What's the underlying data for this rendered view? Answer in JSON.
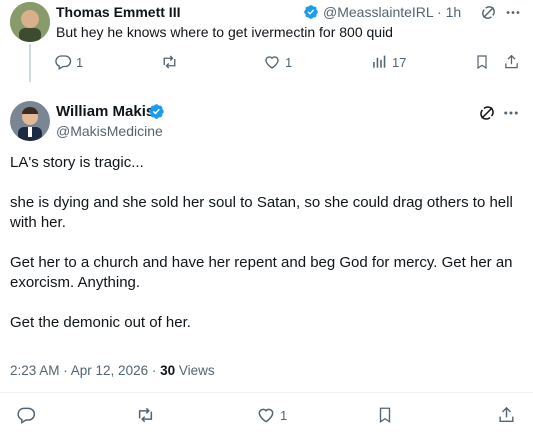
{
  "reply_tweet": {
    "author_name": "Thomas Emmett III",
    "handle": "@MeasslainteIRL",
    "dot": "·",
    "time": "1h",
    "text": "But hey he knows where to get ivermectin for 800 quid",
    "actions": {
      "replies": "1",
      "reposts": "",
      "likes": "1",
      "views": "17"
    }
  },
  "main_tweet": {
    "author_name": "William Makis",
    "handle": "@MakisMedicine",
    "paragraphs": [
      "LA's story is tragic...",
      "she is dying and she sold her soul to Satan, so she could drag others to hell with her.",
      "Get her to a church and have her repent and beg God for mercy. Get her an exorcism. Anything.",
      "Get the demonic out of her."
    ],
    "timestamp": "2:23 AM · Apr 12, 2026 · ",
    "views_count": "30",
    "views_label": " Views",
    "actions": {
      "replies": "",
      "reposts": "",
      "likes": "1",
      "bookmarks": ""
    }
  },
  "colors": {
    "verified": "#1d9bf0",
    "muted": "#536471",
    "text": "#0f1419",
    "divider": "#eff3f4"
  },
  "icons": [
    "verified-badge-icon",
    "grok-icon",
    "more-icon",
    "reply-icon",
    "repost-icon",
    "like-icon",
    "views-icon",
    "bookmark-icon",
    "share-icon"
  ]
}
